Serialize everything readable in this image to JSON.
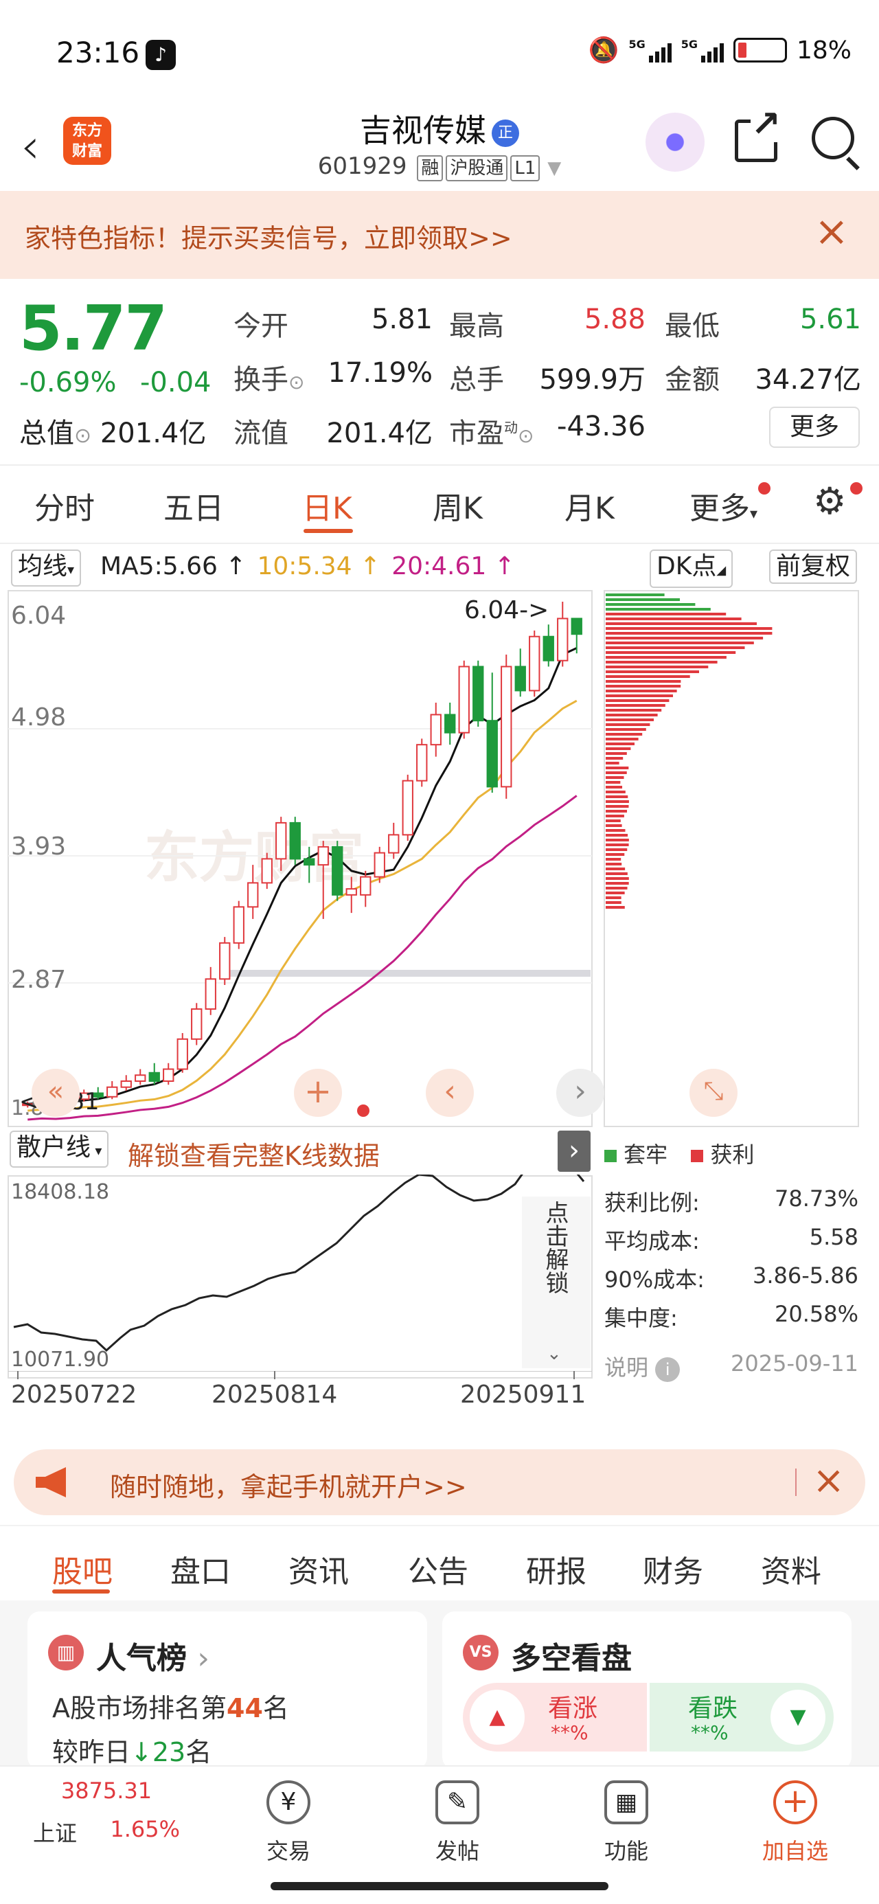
{
  "status": {
    "time": "23:16",
    "battery": "18%",
    "net1": "5G",
    "net2": "5G"
  },
  "header": {
    "logo_line1": "东方",
    "logo_line2": "财富",
    "stock_name": "吉视传媒",
    "badge": "正",
    "code": "601929",
    "tags": [
      "融",
      "沪股通",
      "L1"
    ]
  },
  "promo": {
    "text": "家特色指标！提示买卖信号，立即领取>>",
    "close": "×"
  },
  "quote": {
    "price": "5.77",
    "pct": "-0.69%",
    "chg": "-0.04",
    "cap_label": "总值",
    "cap_value": "201.4亿",
    "open_label": "今开",
    "open": "5.81",
    "high_label": "最高",
    "high": "5.88",
    "low_label": "最低",
    "low": "5.61",
    "turn_label": "换手",
    "turn": "17.19%",
    "vol_label": "总手",
    "vol": "599.9万",
    "amt_label": "金额",
    "amt": "34.27亿",
    "float_label": "流值",
    "float": "201.4亿",
    "pe_label": "市盈",
    "pe_sup": "动",
    "pe": "-43.36",
    "more": "更多"
  },
  "tabs": [
    "分时",
    "五日",
    "日K",
    "周K",
    "月K",
    "更多"
  ],
  "chart_head": {
    "ma_select": "均线",
    "ma5": "MA5:5.66 ↑",
    "ma10": "10:5.34 ↑",
    "ma20": "20:4.61 ↑",
    "dk": "DK点",
    "fq": "前复权"
  },
  "kline": {
    "yticks": [
      "6.04",
      "4.98",
      "3.93",
      "2.87",
      "1.81"
    ],
    "high_mark": "6.04->",
    "low_mark": "<-1.81",
    "sub_select": "散户线",
    "unlock": "解锁查看完整K线数据",
    "sub_max": "18408.18",
    "sub_min": "10071.90",
    "unlock_side": "点击解锁",
    "dates": [
      "20250722",
      "20250814",
      "20250911"
    ]
  },
  "chart_data": {
    "type": "candlestick",
    "ylim": [
      1.81,
      6.04
    ],
    "candles": [
      [
        1.85,
        1.86,
        1.83,
        1.88
      ],
      [
        1.86,
        1.88,
        1.84,
        1.9
      ],
      [
        1.88,
        1.86,
        1.85,
        1.92
      ],
      [
        1.86,
        1.9,
        1.85,
        1.93
      ],
      [
        1.9,
        1.95,
        1.88,
        1.98
      ],
      [
        1.95,
        1.92,
        1.9,
        2.0
      ],
      [
        1.92,
        2.0,
        1.9,
        2.05
      ],
      [
        2.0,
        2.05,
        1.97,
        2.1
      ],
      [
        2.05,
        2.1,
        2.02,
        2.15
      ],
      [
        2.12,
        2.05,
        2.02,
        2.2
      ],
      [
        2.05,
        2.15,
        2.02,
        2.2
      ],
      [
        2.15,
        2.4,
        2.12,
        2.45
      ],
      [
        2.4,
        2.65,
        2.35,
        2.7
      ],
      [
        2.65,
        2.9,
        2.6,
        3.0
      ],
      [
        2.9,
        3.2,
        2.85,
        3.25
      ],
      [
        3.2,
        3.5,
        3.15,
        3.55
      ],
      [
        3.5,
        3.7,
        3.4,
        3.85
      ],
      [
        3.7,
        3.9,
        3.65,
        3.95
      ],
      [
        3.9,
        4.2,
        3.8,
        4.25
      ],
      [
        4.2,
        3.9,
        3.85,
        4.25
      ],
      [
        3.9,
        3.85,
        3.7,
        4.0
      ],
      [
        3.85,
        4.0,
        3.4,
        4.05
      ],
      [
        4.0,
        3.6,
        3.55,
        4.05
      ],
      [
        3.6,
        3.65,
        3.45,
        3.75
      ],
      [
        3.6,
        3.75,
        3.5,
        3.8
      ],
      [
        3.75,
        3.95,
        3.7,
        4.0
      ],
      [
        3.95,
        4.1,
        3.9,
        4.2
      ],
      [
        4.1,
        4.55,
        4.05,
        4.6
      ],
      [
        4.55,
        4.85,
        4.5,
        4.9
      ],
      [
        4.85,
        5.1,
        4.75,
        5.2
      ],
      [
        5.1,
        4.95,
        4.85,
        5.2
      ],
      [
        4.95,
        5.5,
        4.9,
        5.55
      ],
      [
        5.5,
        5.05,
        5.0,
        5.55
      ],
      [
        5.05,
        4.5,
        4.45,
        5.45
      ],
      [
        4.5,
        5.5,
        4.4,
        5.6
      ],
      [
        5.5,
        5.3,
        5.25,
        5.65
      ],
      [
        5.3,
        5.75,
        5.25,
        5.8
      ],
      [
        5.75,
        5.55,
        5.5,
        5.85
      ],
      [
        5.55,
        5.9,
        5.5,
        6.04
      ],
      [
        5.9,
        5.77,
        5.61,
        5.88
      ]
    ],
    "distribution_legend": [
      "套牢",
      "获利"
    ]
  },
  "chip": {
    "ratio_label": "获利比例:",
    "ratio": "78.73%",
    "avg_label": "平均成本:",
    "avg": "5.58",
    "c90_label": "90%成本:",
    "c90": "3.86-5.86",
    "conc_label": "集中度:",
    "conc": "20.58%",
    "note": "说明",
    "date": "2025-09-11"
  },
  "banner": {
    "text": "随时随地，拿起手机就开户>>"
  },
  "subtabs": [
    "股吧",
    "盘口",
    "资讯",
    "公告",
    "研报",
    "财务",
    "资料"
  ],
  "cards": {
    "rank_title": "人气榜",
    "rank_line1a": "A股市场排名第",
    "rank_num": "44",
    "rank_line1b": "名",
    "rank_line2a": "较昨日",
    "rank_delta": "23",
    "rank_line2b": "名",
    "vs_title": "多空看盘",
    "bull": "看涨",
    "bull_pct": "**%",
    "bear": "看跌",
    "bear_pct": "**%"
  },
  "tabbar": {
    "index_val": "3875.31",
    "index_name": "上证",
    "index_pct": "1.65%",
    "items": [
      "交易",
      "发帖",
      "功能",
      "加自选"
    ]
  }
}
